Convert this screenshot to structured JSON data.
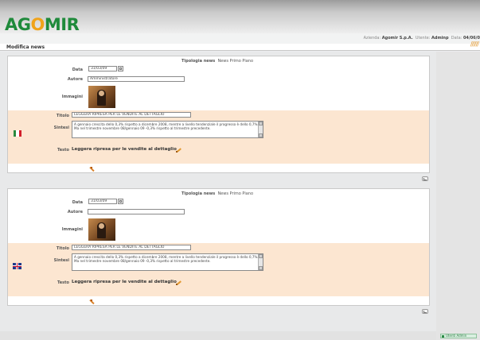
{
  "header": {
    "logo": {
      "part1": "AG",
      "part2": "O",
      "part3": "MIR"
    },
    "info": {
      "azienda_label": "Azienda:",
      "azienda_value": "Agomir S.p.A.",
      "utente_label": "Utente:",
      "utente_value": "Adminp",
      "data_label": "Data:",
      "data_value": "04/06/0"
    }
  },
  "page_title": "Modifica news",
  "panels": [
    {
      "tipologia_label": "Tipologia news",
      "tipologia_value": "News Primo Piano",
      "data_label": "Data",
      "data_value": "31/03/09",
      "autore_label": "Autore",
      "autore_value": "Amministratore",
      "immagini_label": "Immagini",
      "language": "it-flag-icon",
      "titolo_label": "Titolo",
      "titolo_value": "LEGGERA RIPRESA PER LE VENDITE AL DETTAGLIO",
      "sintesi_label": "Sintesi",
      "sintesi_value": "A gennaio crescita dello 0,3% rispetto a dicembre 2008, mentre a livello tendenziale il progresso è dello 0,7%. Ma nel trimestre novembre 08/gennaio 09 -0,3% rispetto al trimestre precedente.",
      "testo_label": "Testo",
      "testo_value": "Leggera ripresa per le vendite al dettaglio"
    },
    {
      "tipologia_label": "Tipologia news",
      "tipologia_value": "News Primo Piano",
      "data_label": "Data",
      "data_value": "31/03/09",
      "autore_label": "Autore",
      "autore_value": "",
      "immagini_label": "Immagini",
      "language": "uk-flag-icon",
      "titolo_label": "Titolo",
      "titolo_value": "LEGGERA RIPRESA PER LE VENDITE AL DETTAGLIO",
      "sintesi_label": "Sintesi",
      "sintesi_value": "A gennaio crescita dello 0,3% rispetto a dicembre 2008, mentre a livello tendenziale il progresso è dello 0,7%. Ma nel trimestre novembre 08/gennaio 09 -0,3% rispetto al trimestre precedente.",
      "testo_label": "Testo",
      "testo_value": "Leggera ripresa per le vendite al dettaglio"
    }
  ],
  "status_bar": {
    "text": "Utenti Admin"
  },
  "colors": {
    "logo_green": "#1f8a3b",
    "logo_orange": "#f0a31a",
    "warm_row": "#fce6d1",
    "accent": "#e39a32"
  }
}
